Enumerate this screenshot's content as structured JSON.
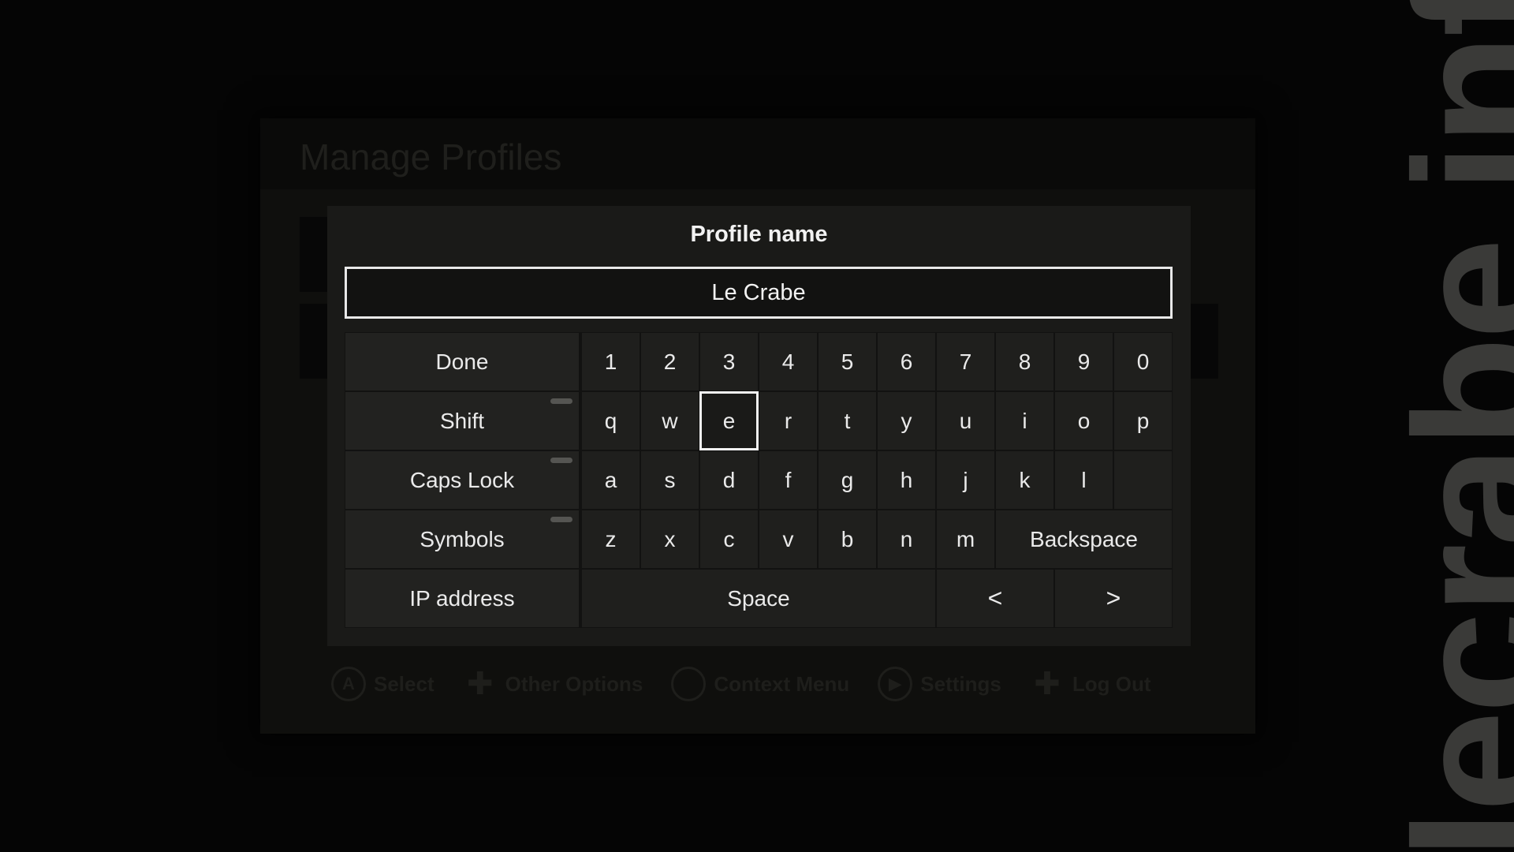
{
  "background": {
    "title": "Manage Profiles",
    "hints": [
      {
        "icon": "a-button-icon",
        "glyph": "A",
        "label": "Select"
      },
      {
        "icon": "dpad-icon",
        "glyph": "✚",
        "label": "Other Options"
      },
      {
        "icon": "context-button-icon",
        "glyph": "",
        "label": "Context Menu"
      },
      {
        "icon": "start-button-icon",
        "glyph": "▶",
        "label": "Settings"
      },
      {
        "icon": "dpad-down-icon",
        "glyph": "✚",
        "label": "Log Out"
      }
    ]
  },
  "dialog": {
    "title": "Profile name",
    "input_value": "Le Crabe"
  },
  "keyboard": {
    "done": "Done",
    "shift": "Shift",
    "caps_lock": "Caps Lock",
    "symbols": "Symbols",
    "ip_address": "IP address",
    "space": "Space",
    "backspace": "Backspace",
    "left": "<",
    "right": ">",
    "row1": [
      "1",
      "2",
      "3",
      "4",
      "5",
      "6",
      "7",
      "8",
      "9",
      "0"
    ],
    "row2": [
      "q",
      "w",
      "e",
      "r",
      "t",
      "y",
      "u",
      "i",
      "o",
      "p"
    ],
    "row3": [
      "a",
      "s",
      "d",
      "f",
      "g",
      "h",
      "j",
      "k",
      "l",
      ""
    ],
    "row4": [
      "z",
      "x",
      "c",
      "v",
      "b",
      "n",
      "m"
    ],
    "focused_key": "e"
  },
  "watermark": "lecrabe.info",
  "colors": {
    "dialog_bg": "#1a1a18",
    "key_bg": "#1f1f1d",
    "text": "#eaeaea",
    "focus_border": "#f2f2f2"
  }
}
